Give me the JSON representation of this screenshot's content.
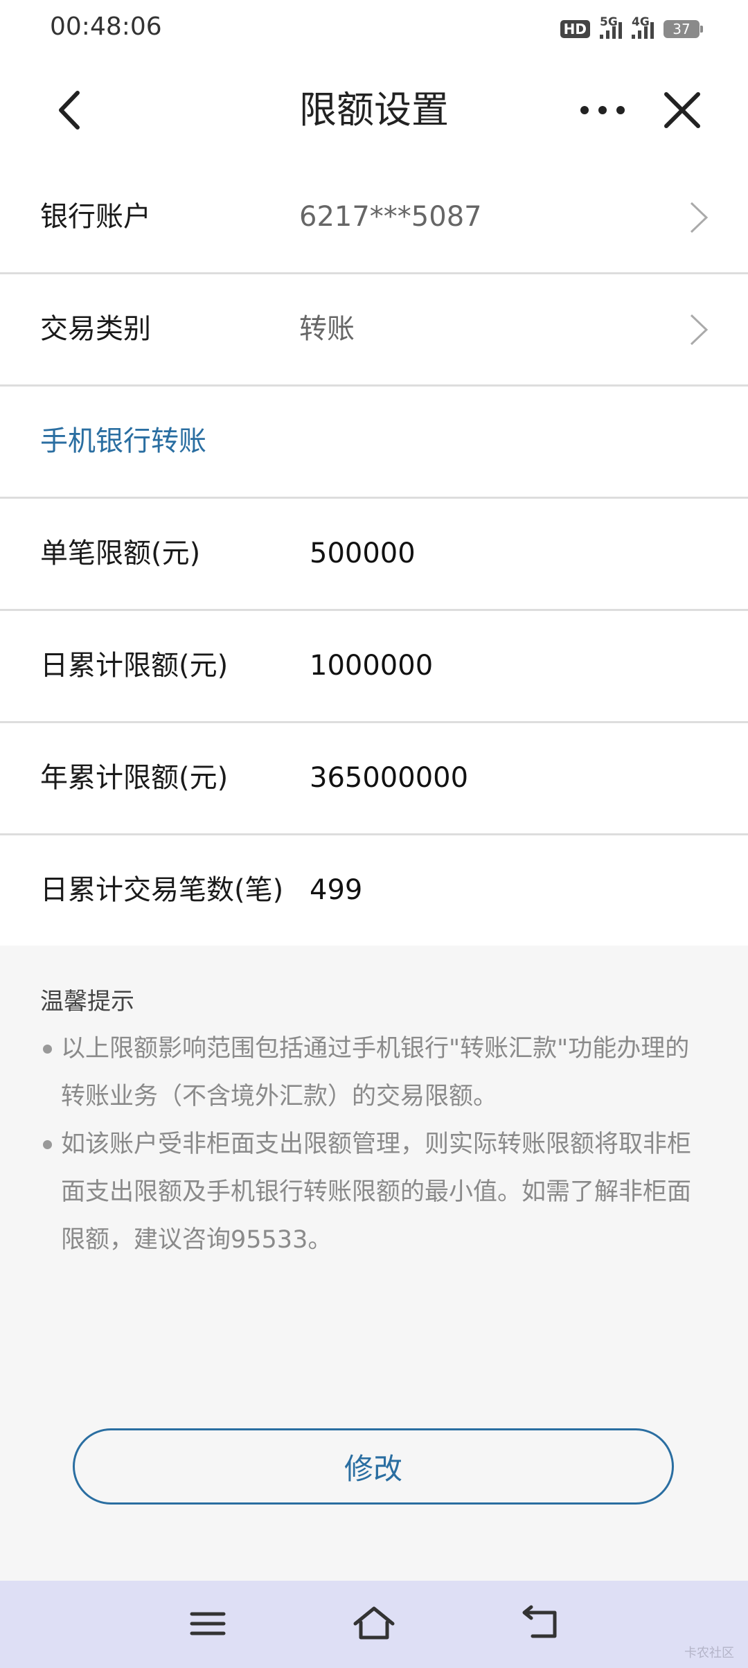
{
  "status_bar": {
    "time": "00:48:06",
    "hd_label": "HD",
    "network_5g": "5G",
    "network_4g": "4G",
    "battery": "37"
  },
  "nav": {
    "title": "限额设置",
    "back_icon": "chevron-left-icon",
    "more_icon": "more-icon",
    "close_icon": "close-icon"
  },
  "rows": {
    "account_label": "银行账户",
    "account_value": "6217***5087",
    "type_label": "交易类别",
    "type_value": "转账",
    "section_label": "手机银行转账",
    "single_label": "单笔限额(元)",
    "single_value": "500000",
    "daily_label": "日累计限额(元)",
    "daily_value": "1000000",
    "yearly_label": "年累计限额(元)",
    "yearly_value": "365000000",
    "count_label": "日累计交易笔数(笔)",
    "count_value": "499"
  },
  "tips": {
    "title": "温馨提示",
    "items": [
      "以上限额影响范围包括通过手机银行\"转账汇款\"功能办理的转账业务（不含境外汇款）的交易限额。",
      "如该账户受非柜面支出限额管理，则实际转账限额将取非柜面支出限额及手机银行转账限额的最小值。如需了解非柜面限额，建议咨询95533。"
    ]
  },
  "modify_label": "修改",
  "bottom_nav": {
    "menu_icon": "menu-icon",
    "home_icon": "home-icon",
    "back_icon": "back-icon",
    "watermark": "卡农社区"
  },
  "colors": {
    "accent": "#2a6ea1",
    "bottom_bar": "#dedff5"
  }
}
